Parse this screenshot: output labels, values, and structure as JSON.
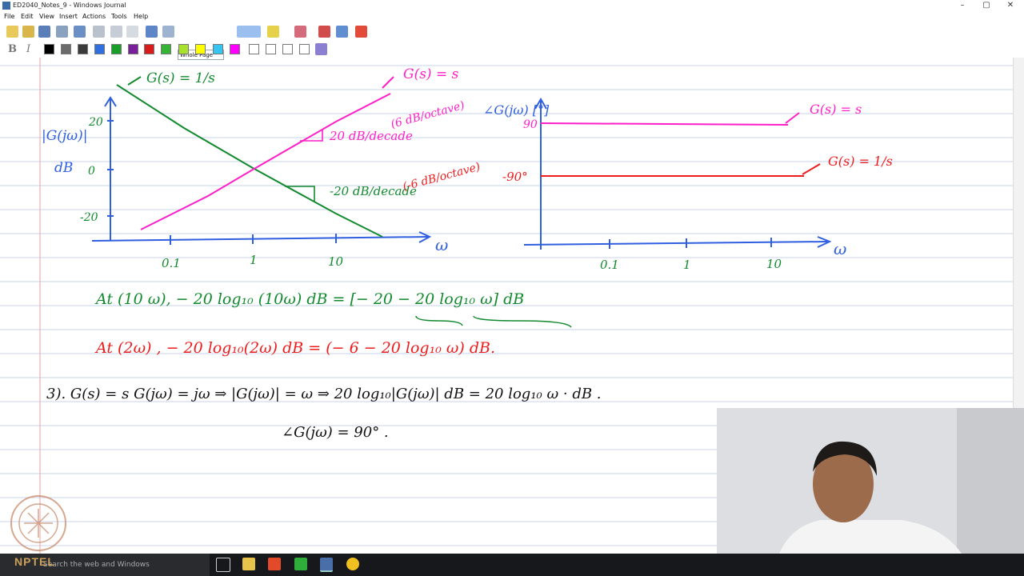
{
  "window": {
    "title": "ED2040_Notes_9 - Windows Journal",
    "minimize": "–",
    "maximize": "▢",
    "close": "✕"
  },
  "menu": [
    "File",
    "Edit",
    "View",
    "Insert",
    "Actions",
    "Tools",
    "Help"
  ],
  "toolbar": {
    "zoom_value": "Whole Page",
    "bold_label": "B",
    "italic_label": "I"
  },
  "palette": [
    "#000000",
    "#6b6b6b",
    "#3a3a3a",
    "#2f6fdf",
    "#1a9e2a",
    "#7a1f9c",
    "#d81b1b",
    "#35b335",
    "#a8e22d",
    "#ffff00",
    "#35c5f0",
    "#ff00ff",
    "#ffffff",
    "#ffffff",
    "#ffffff",
    "#ffffff"
  ],
  "colors": {
    "blue": "#2f5fe0",
    "green": "#128a2e",
    "magenta": "#ff1fc8",
    "red": "#ee1c1c",
    "margin_line": "#f0a0a0",
    "rule_line": "#c9d3ee"
  },
  "notes": {
    "mag_plot": {
      "ylabel_1": "|G(jω)|",
      "ylabel_2": "dB",
      "yticks": [
        "20",
        "0",
        "-20"
      ],
      "xticks": [
        "0.1",
        "1",
        "10"
      ],
      "xlabel": "ω",
      "label_integrator": "G(s) = 1/s",
      "label_differentiator": "G(s) = s",
      "slope_pos": "20 dB/decade",
      "slope_pos_octave": "(6 dB/octave)",
      "slope_neg": "-20 dB/decade",
      "slope_neg_octave": "(-6 dB/octave)"
    },
    "phase_plot": {
      "ylabel": "∠G(jω) [°]",
      "ytick_pos": "90",
      "ytick_neg": "-90°",
      "xticks": [
        "0.1",
        "1",
        "10"
      ],
      "xlabel": "ω",
      "label_s": "G(s) = s",
      "label_inv_s": "G(s) = 1/s"
    },
    "line1": "At (10 ω),  − 20 log₁₀ (10ω)  dB = [− 20  − 20 log₁₀ ω] dB",
    "line2": "At (2ω) ,  − 20 log₁₀(2ω) dB  =  (− 6  − 20 log₁₀ ω)  dB.",
    "line3": "3).  G(s) = s      G(jω) = jω  ⇒  |G(jω)| = ω   ⇒  20 log₁₀|G(jω)| dB  =  20 log₁₀ ω · dB .",
    "line4": "∠G(jω)  =  90° ."
  },
  "taskbar": {
    "search_text": "Search the web and Windows",
    "brand": "NPTEL"
  }
}
